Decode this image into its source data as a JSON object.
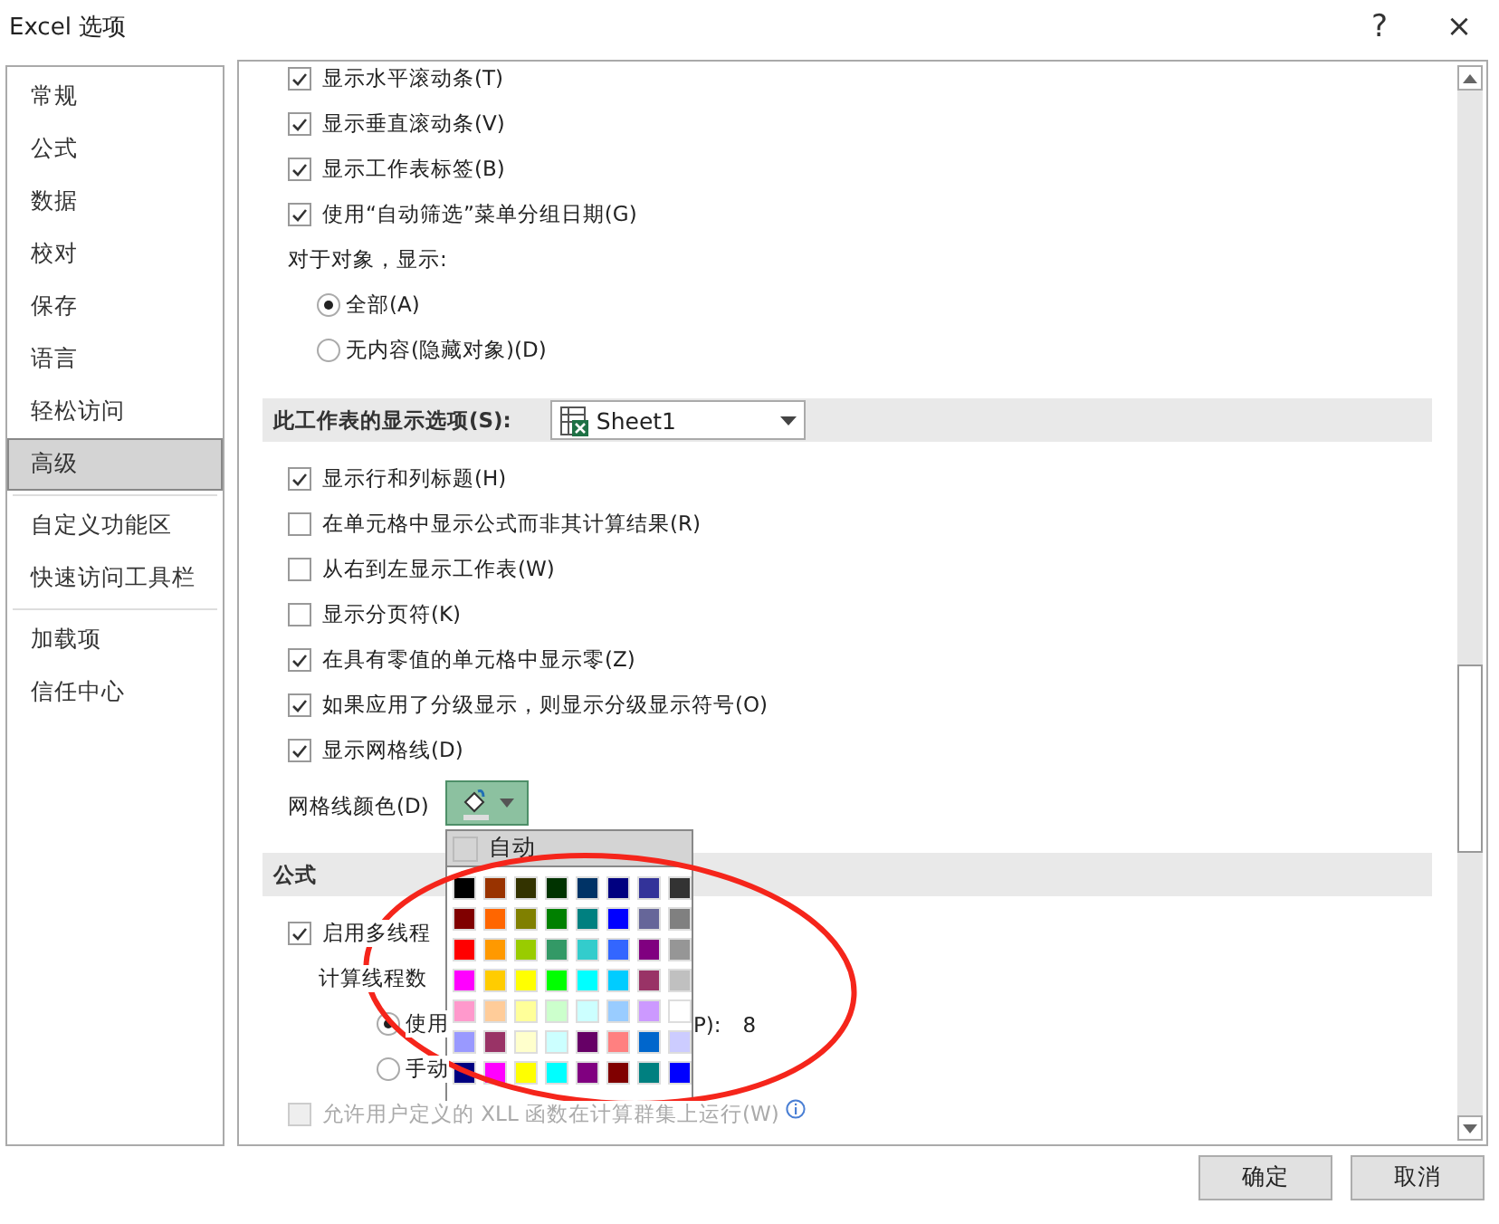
{
  "window": {
    "title": "Excel 选项",
    "buttons": [
      "?",
      "×"
    ]
  },
  "sidebar": {
    "groups": [
      [
        {
          "label": "常规",
          "selected": false
        },
        {
          "label": "公式",
          "selected": false
        },
        {
          "label": "数据",
          "selected": false
        },
        {
          "label": "校对",
          "selected": false
        },
        {
          "label": "保存",
          "selected": false
        },
        {
          "label": "语言",
          "selected": false
        },
        {
          "label": "轻松访问",
          "selected": false
        },
        {
          "label": "高级",
          "selected": true
        }
      ],
      [
        {
          "label": "自定义功能区",
          "selected": false
        },
        {
          "label": "快速访问工具栏",
          "selected": false
        }
      ],
      [
        {
          "label": "加载项",
          "selected": false
        },
        {
          "label": "信任中心",
          "selected": false
        }
      ]
    ]
  },
  "content": {
    "items": [
      {
        "kind": "checkbox",
        "label": "显示水平滚动条(T)",
        "checked": true
      },
      {
        "kind": "checkbox",
        "label": "显示垂直滚动条(V)",
        "checked": true
      },
      {
        "kind": "checkbox",
        "label": "显示工作表标签(B)",
        "checked": true
      },
      {
        "kind": "checkbox",
        "label": "使用“自动筛选”菜单分组日期(G)",
        "checked": true
      },
      {
        "kind": "label",
        "label": "对于对象，显示:",
        "children": [
          {
            "kind": "radio",
            "label": "全部(A)",
            "selected": true
          },
          {
            "kind": "radio",
            "label": "无内容(隐藏对象)(D)",
            "selected": false
          }
        ]
      },
      {
        "kind": "section",
        "label": "此工作表的显示选项(S):",
        "dropdown": {
          "value": "Sheet1"
        }
      },
      {
        "kind": "checkbox",
        "label": "显示行和列标题(H)",
        "checked": true
      },
      {
        "kind": "checkbox",
        "label": "在单元格中显示公式而非其计算结果(R)",
        "checked": false
      },
      {
        "kind": "checkbox",
        "label": "从右到左显示工作表(W)",
        "checked": false
      },
      {
        "kind": "checkbox",
        "label": "显示分页符(K)",
        "checked": false
      },
      {
        "kind": "checkbox",
        "label": "在具有零值的单元格中显示零(Z)",
        "checked": true
      },
      {
        "kind": "checkbox",
        "label": "如果应用了分级显示，则显示分级显示符号(O)",
        "checked": true
      },
      {
        "kind": "checkbox",
        "label": "显示网格线(D)",
        "checked": true
      },
      {
        "kind": "color_picker",
        "label": "网格线颜色(D)",
        "expanded": true,
        "popup": {
          "auto_label": "自动",
          "swatches": [
            {
              "color": "#000000"
            },
            {
              "color": "#993300"
            },
            {
              "color": "#333300"
            },
            {
              "color": "#003300"
            },
            {
              "color": "#003366"
            },
            {
              "color": "#000080"
            },
            {
              "color": "#333399"
            },
            {
              "color": "#333333"
            },
            {
              "color": "#800000"
            },
            {
              "color": "#ff6600"
            },
            {
              "color": "#808000"
            },
            {
              "color": "#008000"
            },
            {
              "color": "#008080"
            },
            {
              "color": "#0000ff"
            },
            {
              "color": "#666699"
            },
            {
              "color": "#808080"
            },
            {
              "color": "#ff0000"
            },
            {
              "color": "#ff9900"
            },
            {
              "color": "#99cc00"
            },
            {
              "color": "#339966"
            },
            {
              "color": "#33cccc"
            },
            {
              "color": "#3366ff"
            },
            {
              "color": "#800080"
            },
            {
              "color": "#969696"
            },
            {
              "color": "#ff00ff"
            },
            {
              "color": "#ffcc00"
            },
            {
              "color": "#ffff00"
            },
            {
              "color": "#00ff00"
            },
            {
              "color": "#00ffff"
            },
            {
              "color": "#00ccff"
            },
            {
              "color": "#993366"
            },
            {
              "color": "#c0c0c0"
            },
            {
              "color": "#ff99cc"
            },
            {
              "color": "#ffcc99"
            },
            {
              "color": "#ffff99"
            },
            {
              "color": "#ccffcc"
            },
            {
              "color": "#ccffff"
            },
            {
              "color": "#99ccff"
            },
            {
              "color": "#cc99ff"
            },
            {
              "color": "#ffffff"
            },
            {
              "color": "#9999ff"
            },
            {
              "color": "#993366"
            },
            {
              "color": "#ffffcc"
            },
            {
              "color": "#ccffff"
            },
            {
              "color": "#660066"
            },
            {
              "color": "#ff8080"
            },
            {
              "color": "#0066cc"
            },
            {
              "color": "#ccccff"
            },
            {
              "color": "#000080"
            },
            {
              "color": "#ff00ff"
            },
            {
              "color": "#ffff00"
            },
            {
              "color": "#00ffff"
            },
            {
              "color": "#800080"
            },
            {
              "color": "#800000"
            },
            {
              "color": "#008080"
            },
            {
              "color": "#0000ff"
            }
          ]
        }
      },
      {
        "kind": "section",
        "label": "公式"
      },
      {
        "kind": "checkbox",
        "label": "启用多线程",
        "checked": true,
        "children": [
          {
            "kind": "label",
            "label": "计算线程数",
            "children": [
              {
                "kind": "radio",
                "label": "使用",
                "selected": true,
                "trailing": [
                  "P):",
                  "8"
                ]
              },
              {
                "kind": "radio",
                "label": "手动",
                "selected": false
              }
            ]
          }
        ]
      },
      {
        "kind": "checkbox",
        "label": "允许用户定义的 XLL 函数在计算群集上运行(W)",
        "checked": false,
        "disabled": true,
        "info": true
      }
    ]
  },
  "buttons": [
    "确定",
    "取消"
  ]
}
